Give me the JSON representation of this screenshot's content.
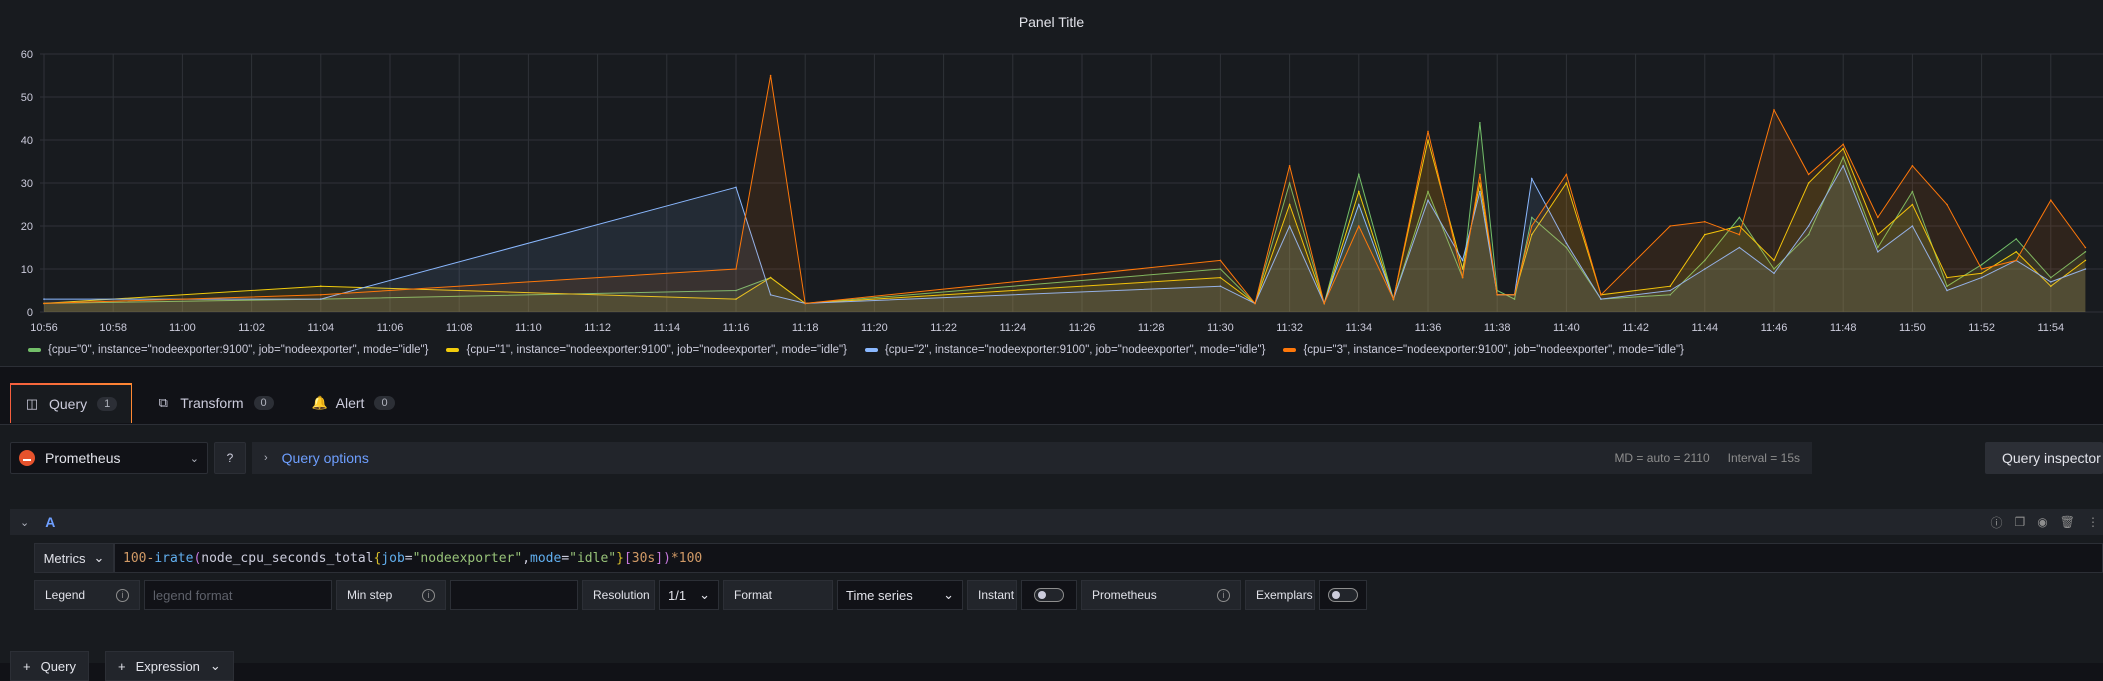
{
  "panel": {
    "title": "Panel Title"
  },
  "colors": {
    "cpu0": "#73bf69",
    "cpu1": "#f2cc0c",
    "cpu2": "#8ab8ff",
    "cpu3": "#ff780a"
  },
  "chart_data": {
    "type": "area",
    "title": "Panel Title",
    "ylim": [
      0,
      60
    ],
    "y_ticks": [
      "0",
      "10",
      "20",
      "30",
      "40",
      "50",
      "60"
    ],
    "x_ticks": [
      "10:56",
      "10:58",
      "11:00",
      "11:02",
      "11:04",
      "11:06",
      "11:08",
      "11:10",
      "11:12",
      "11:14",
      "11:16",
      "11:18",
      "11:20",
      "11:22",
      "11:24",
      "11:26",
      "11:28",
      "11:30",
      "11:32",
      "11:34",
      "11:36",
      "11:38",
      "11:40",
      "11:42",
      "11:44",
      "11:46",
      "11:48",
      "11:50",
      "11:52",
      "11:54"
    ],
    "grid": true,
    "legend_position": "bottom",
    "series": [
      {
        "name": "{cpu=\"0\", instance=\"nodeexporter:9100\", job=\"nodeexporter\", mode=\"idle\"}",
        "color": "#73bf69",
        "points": [
          [
            "10:56",
            2
          ],
          [
            "11:04",
            3
          ],
          [
            "11:16",
            5
          ],
          [
            "11:17",
            8
          ],
          [
            "11:18",
            2
          ],
          [
            "11:30",
            10
          ],
          [
            "11:31",
            2
          ],
          [
            "11:32",
            30
          ],
          [
            "11:33",
            2
          ],
          [
            "11:34",
            32
          ],
          [
            "11:35",
            3
          ],
          [
            "11:36",
            28
          ],
          [
            "11:37",
            8
          ],
          [
            "11:38",
            5
          ],
          [
            "11:37:30",
            44
          ],
          [
            "11:38:30",
            3
          ],
          [
            "11:39",
            22
          ],
          [
            "11:40",
            15
          ],
          [
            "11:41",
            3
          ],
          [
            "11:43",
            4
          ],
          [
            "11:44",
            12
          ],
          [
            "11:45",
            22
          ],
          [
            "11:46",
            10
          ],
          [
            "11:47",
            18
          ],
          [
            "11:48",
            36
          ],
          [
            "11:49",
            15
          ],
          [
            "11:50",
            28
          ],
          [
            "11:51",
            6
          ],
          [
            "11:52",
            11
          ],
          [
            "11:53",
            17
          ],
          [
            "11:54",
            8
          ],
          [
            "11:55",
            14
          ]
        ]
      },
      {
        "name": "{cpu=\"1\", instance=\"nodeexporter:9100\", job=\"nodeexporter\", mode=\"idle\"}",
        "color": "#f2cc0c",
        "points": [
          [
            "10:56",
            2
          ],
          [
            "11:04",
            6
          ],
          [
            "11:16",
            3
          ],
          [
            "11:17",
            8
          ],
          [
            "11:18",
            2
          ],
          [
            "11:30",
            8
          ],
          [
            "11:31",
            2
          ],
          [
            "11:32",
            25
          ],
          [
            "11:33",
            2
          ],
          [
            "11:34",
            28
          ],
          [
            "11:35",
            3
          ],
          [
            "11:36",
            40
          ],
          [
            "11:37",
            10
          ],
          [
            "11:38",
            4
          ],
          [
            "11:37:30",
            30
          ],
          [
            "11:38:30",
            4
          ],
          [
            "11:39",
            18
          ],
          [
            "11:40",
            30
          ],
          [
            "11:41",
            4
          ],
          [
            "11:43",
            6
          ],
          [
            "11:44",
            18
          ],
          [
            "11:45",
            20
          ],
          [
            "11:46",
            12
          ],
          [
            "11:47",
            30
          ],
          [
            "11:48",
            38
          ],
          [
            "11:49",
            18
          ],
          [
            "11:50",
            25
          ],
          [
            "11:51",
            8
          ],
          [
            "11:52",
            9
          ],
          [
            "11:53",
            14
          ],
          [
            "11:54",
            6
          ],
          [
            "11:55",
            12
          ]
        ]
      },
      {
        "name": "{cpu=\"2\", instance=\"nodeexporter:9100\", job=\"nodeexporter\", mode=\"idle\"}",
        "color": "#8ab8ff",
        "points": [
          [
            "10:56",
            3
          ],
          [
            "11:04",
            3
          ],
          [
            "11:16",
            29
          ],
          [
            "11:17",
            4
          ],
          [
            "11:18",
            2
          ],
          [
            "11:30",
            6
          ],
          [
            "11:31",
            2
          ],
          [
            "11:32",
            20
          ],
          [
            "11:33",
            2
          ],
          [
            "11:34",
            25
          ],
          [
            "11:35",
            3
          ],
          [
            "11:36",
            26
          ],
          [
            "11:37",
            12
          ],
          [
            "11:38",
            4
          ],
          [
            "11:37:30",
            28
          ],
          [
            "11:38:30",
            4
          ],
          [
            "11:39",
            31
          ],
          [
            "11:40",
            16
          ],
          [
            "11:41",
            3
          ],
          [
            "11:43",
            5
          ],
          [
            "11:44",
            10
          ],
          [
            "11:45",
            15
          ],
          [
            "11:46",
            9
          ],
          [
            "11:47",
            20
          ],
          [
            "11:48",
            34
          ],
          [
            "11:49",
            14
          ],
          [
            "11:50",
            20
          ],
          [
            "11:51",
            5
          ],
          [
            "11:52",
            8
          ],
          [
            "11:53",
            12
          ],
          [
            "11:54",
            7
          ],
          [
            "11:55",
            10
          ]
        ]
      },
      {
        "name": "{cpu=\"3\", instance=\"nodeexporter:9100\", job=\"nodeexporter\", mode=\"idle\"}",
        "color": "#ff780a",
        "points": [
          [
            "10:56",
            2
          ],
          [
            "11:04",
            4
          ],
          [
            "11:16",
            10
          ],
          [
            "11:17",
            55
          ],
          [
            "11:18",
            2
          ],
          [
            "11:30",
            12
          ],
          [
            "11:31",
            2
          ],
          [
            "11:32",
            34
          ],
          [
            "11:33",
            2
          ],
          [
            "11:34",
            20
          ],
          [
            "11:35",
            3
          ],
          [
            "11:36",
            42
          ],
          [
            "11:37",
            8
          ],
          [
            "11:38",
            4
          ],
          [
            "11:37:30",
            32
          ],
          [
            "11:38:30",
            4
          ],
          [
            "11:39",
            20
          ],
          [
            "11:40",
            32
          ],
          [
            "11:41",
            4
          ],
          [
            "11:43",
            20
          ],
          [
            "11:44",
            21
          ],
          [
            "11:45",
            18
          ],
          [
            "11:46",
            47
          ],
          [
            "11:47",
            32
          ],
          [
            "11:48",
            39
          ],
          [
            "11:49",
            22
          ],
          [
            "11:50",
            34
          ],
          [
            "11:51",
            25
          ],
          [
            "11:52",
            10
          ],
          [
            "11:53",
            12
          ],
          [
            "11:54",
            26
          ],
          [
            "11:55",
            15
          ]
        ]
      }
    ]
  },
  "legend": [
    {
      "label": "{cpu=\"0\", instance=\"nodeexporter:9100\", job=\"nodeexporter\", mode=\"idle\"}",
      "color": "#73bf69"
    },
    {
      "label": "{cpu=\"1\", instance=\"nodeexporter:9100\", job=\"nodeexporter\", mode=\"idle\"}",
      "color": "#f2cc0c"
    },
    {
      "label": "{cpu=\"2\", instance=\"nodeexporter:9100\", job=\"nodeexporter\", mode=\"idle\"}",
      "color": "#8ab8ff"
    },
    {
      "label": "{cpu=\"3\", instance=\"nodeexporter:9100\", job=\"nodeexporter\", mode=\"idle\"}",
      "color": "#ff780a"
    }
  ],
  "tabs": [
    {
      "label": "Query",
      "count": "1",
      "icon": "database-icon"
    },
    {
      "label": "Transform",
      "count": "0",
      "icon": "transform-icon"
    },
    {
      "label": "Alert",
      "count": "0",
      "icon": "bell-icon"
    }
  ],
  "datasource": {
    "name": "Prometheus"
  },
  "query_options": {
    "label": "Query options",
    "md": "MD = auto = 2110",
    "interval": "Interval = 15s"
  },
  "inspector": {
    "label": "Query inspector"
  },
  "query": {
    "ref_id": "A",
    "metrics_label": "Metrics",
    "expr_parts": {
      "a": "100-",
      "b": "irate",
      "c": "(",
      "d": "node_cpu_seconds_total",
      "e": "{",
      "f": "job",
      "g": "=",
      "h": "\"nodeexporter\"",
      "i": ",",
      "j": "mode",
      "k": "=",
      "l": "\"idle\"",
      "m": "}",
      "n": "[",
      "o": "30s",
      "p": "]",
      "q": ")",
      "r": "*100"
    }
  },
  "options": {
    "legend_label": "Legend",
    "legend_placeholder": "legend format",
    "min_step_label": "Min step",
    "resolution_label": "Resolution",
    "resolution_value": "1/1",
    "format_label": "Format",
    "format_value": "Time series",
    "instant_label": "Instant",
    "prometheus_label": "Prometheus",
    "exemplars_label": "Exemplars"
  },
  "bottom": {
    "b1": "Query",
    "b2": "Expression"
  }
}
